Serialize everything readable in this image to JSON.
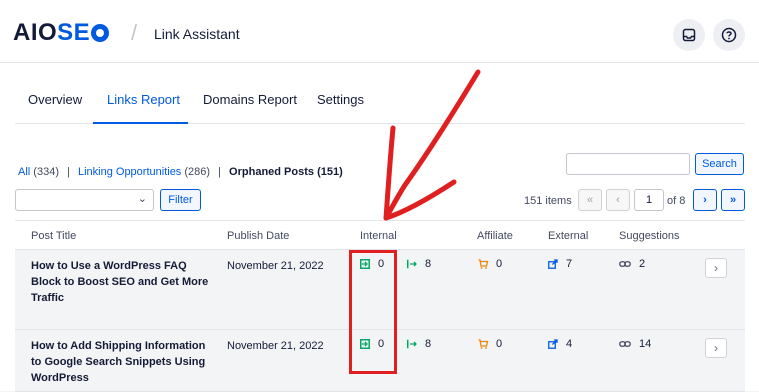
{
  "header": {
    "logo_a": "AIO",
    "logo_b": "SE",
    "page_title": "Link Assistant",
    "sep": "/"
  },
  "tabs": [
    {
      "label": "Overview",
      "active": false
    },
    {
      "label": "Links Report",
      "active": true
    },
    {
      "label": "Domains Report",
      "active": false
    },
    {
      "label": "Settings",
      "active": false
    }
  ],
  "filters": {
    "all_label": "All",
    "all_count": "(334)",
    "linking_label": "Linking Opportunities",
    "linking_count": "(286)",
    "orphaned_label": "Orphaned Posts (151)",
    "pipe": "|"
  },
  "search": {
    "button": "Search"
  },
  "bulk": {
    "filter_button": "Filter",
    "chevron": "⌄"
  },
  "pagination": {
    "items": "151 items",
    "first": "«",
    "prev": "‹",
    "current": "1",
    "of": "of 8",
    "next": "›",
    "last": "»"
  },
  "table": {
    "headers": [
      "Post Title",
      "Publish Date",
      "Internal",
      "Affiliate",
      "External",
      "Suggestions"
    ],
    "rows": [
      {
        "title": "How to Use a WordPress FAQ Block to Boost SEO and Get More Traffic",
        "date": "November 21, 2022",
        "inbound": "0",
        "outbound": "8",
        "affiliate": "0",
        "external": "7",
        "suggestions": "2",
        "arrow": "›"
      },
      {
        "title": "How to Add Shipping Information to Google Search Snippets Using WordPress",
        "date": "November 21, 2022",
        "inbound": "0",
        "outbound": "8",
        "affiliate": "0",
        "external": "4",
        "suggestions": "14",
        "arrow": "›"
      }
    ]
  },
  "colors": {
    "accent": "#005ae0",
    "green": "#00aa63",
    "orange": "#f18200",
    "annotation": "#e02020"
  },
  "icons": [
    "gear-icon",
    "inbox-icon",
    "help-icon",
    "chevron-down-icon",
    "inbound-link-icon",
    "outbound-link-icon",
    "cart-icon",
    "external-link-icon",
    "link-icon",
    "chevron-right-icon"
  ]
}
